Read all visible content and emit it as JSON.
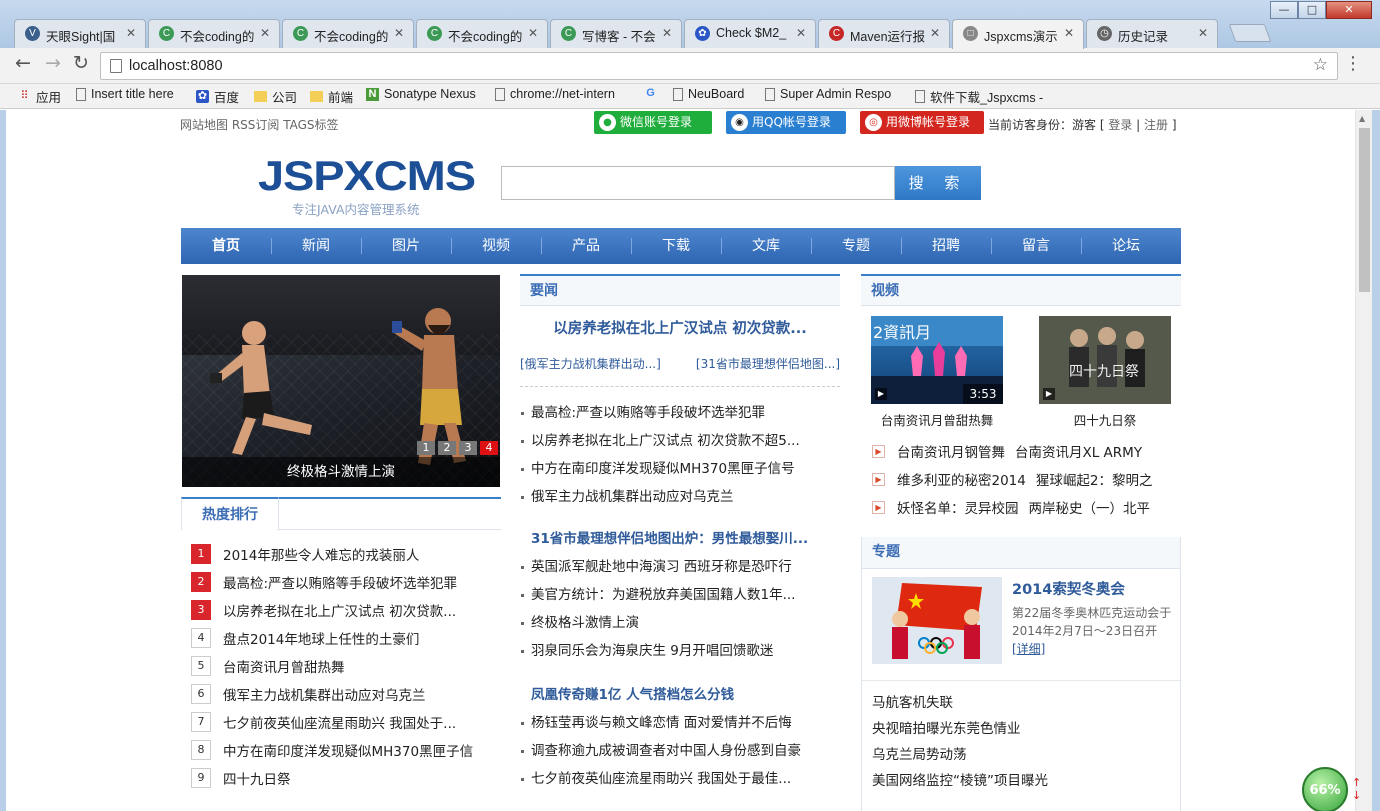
{
  "browser": {
    "tabs": [
      {
        "label": "天眼Sight|国",
        "icon": "V",
        "color": "#3a5f8a"
      },
      {
        "label": "不会coding的",
        "icon": "C",
        "color": "#3d9a56"
      },
      {
        "label": "不会coding的",
        "icon": "C",
        "color": "#3d9a56"
      },
      {
        "label": "不会coding的",
        "icon": "C",
        "color": "#3d9a56"
      },
      {
        "label": "写博客 - 不会",
        "icon": "C",
        "color": "#3d9a56"
      },
      {
        "label": "Check $M2_",
        "icon": "✿",
        "color": "#2a56c6"
      },
      {
        "label": "Maven运行报",
        "icon": "C",
        "color": "#c62828"
      },
      {
        "label": "Jspxcms演示",
        "icon": "□",
        "color": "#888888"
      },
      {
        "label": "历史记录",
        "icon": "◷",
        "color": "#666666"
      }
    ],
    "url": "localhost:8080",
    "bookmarks": [
      "应用",
      "Insert title here",
      "百度",
      "公司",
      "前端",
      "Sonatype Nexus",
      "chrome://net-intern",
      "NeuBoard",
      "Super Admin Respo",
      "软件下载_Jspxcms - "
    ],
    "zoom": "66%"
  },
  "site": {
    "toplinks": "网站地图 RSS订阅 TAGS标签",
    "login_wechat": "微信账号登录",
    "login_qq": "用QQ帐号登录",
    "login_weibo": "用微博帐号登录",
    "guest_prefix": "当前访客身份：游客 [",
    "login": "登录",
    "sep": "|",
    "register": "注册",
    "guest_suffix": "]",
    "logo": "JSPXCMS",
    "slogan": "专注JAVA内容管理系统",
    "search_button": "搜 索",
    "search_value": "",
    "nav": [
      "首页",
      "新闻",
      "图片",
      "视频",
      "产品",
      "下载",
      "文库",
      "专题",
      "招聘",
      "留言",
      "论坛"
    ]
  },
  "slideshow": {
    "caption": "终极格斗激情上演",
    "pages": [
      "1",
      "2",
      "3",
      "4"
    ]
  },
  "hot": {
    "tab": "热度排行",
    "items": [
      "2014年那些令人难忘的戎装丽人",
      "最高检:严查以贿赂等手段破坏选举犯罪",
      "以房养老拟在北上广汉试点 初次贷款...",
      "盘点2014年地球上任性的土豪们",
      "台南资讯月曾甜热舞",
      "俄军主力战机集群出动应对乌克兰",
      "七夕前夜英仙座流星雨助兴 我国处于...",
      "中方在南印度洋发现疑似MH370黑匣子信",
      "四十九日祭"
    ]
  },
  "news": {
    "heading": "要闻",
    "headline": "以房养老拟在北上广汉试点 初次贷款...",
    "sub1": "[俄军主力战机集群出动...]",
    "sub2": "[31省市最理想伴侣地图...]",
    "group1": [
      "最高检:严查以贿赂等手段破坏选举犯罪",
      "以房养老拟在北上广汉试点 初次贷款不超5...",
      "中方在南印度洋发现疑似MH370黑匣子信号",
      "俄军主力战机集群出动应对乌克兰"
    ],
    "headline2": "31省市最理想伴侣地图出炉：男性最想娶川...",
    "group2": [
      "英国派军舰赴地中海演习 西班牙称是恐吓行",
      "美官方统计：为避税放弃美国国籍人数1年...",
      "终极格斗激情上演",
      "羽泉同乐会为海泉庆生 9月开唱回馈歌迷"
    ],
    "headline3": "凤凰传奇赚1亿 人气搭档怎么分钱",
    "group3": [
      "杨钰莹再谈与赖文峰恋情 面对爱情并不后悔",
      "调查称逾九成被调查者对中国人身份感到自豪",
      "七夕前夜英仙座流星雨助兴 我国处于最佳..."
    ]
  },
  "video": {
    "heading": "视频",
    "items": [
      {
        "title": "台南资讯月曾甜热舞",
        "duration": "3:53"
      },
      {
        "title": "四十九日祭",
        "duration": ""
      }
    ],
    "list": [
      [
        "台南资讯月钢管舞",
        "台南资讯月XL ARMY"
      ],
      [
        "维多利亚的秘密2014",
        "猩球崛起2：黎明之"
      ],
      [
        "妖怪名单：灵异校园",
        "两岸秘史（一）北平"
      ]
    ]
  },
  "topic": {
    "heading": "专题",
    "title": "2014索契冬奥会",
    "desc": "第22届冬季奥林匹克运动会于2014年2月7日～23日召开",
    "more": "[详细]",
    "list": [
      "马航客机失联",
      "央视暗拍曝光东莞色情业",
      "乌克兰局势动荡",
      "美国网络监控“棱镜”项目曝光"
    ]
  }
}
